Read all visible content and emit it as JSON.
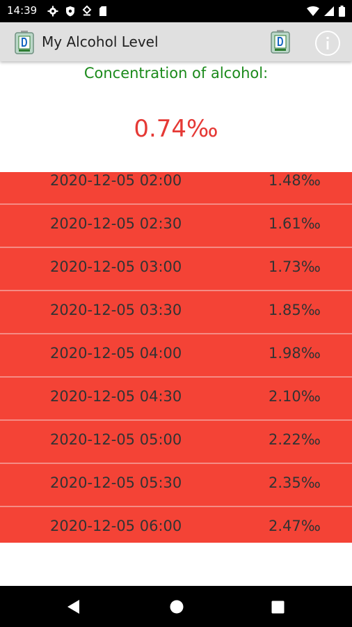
{
  "status_bar": {
    "time": "14:39",
    "left_icons": [
      "settings-gear-icon",
      "shield-icon",
      "vpn-key-icon",
      "sd-card-icon"
    ],
    "right_icons": [
      "wifi-icon",
      "signal-icon",
      "battery-icon"
    ]
  },
  "app_bar": {
    "title": "My Alcohol Level",
    "logo_icon": "breathalyzer-icon",
    "action_icon": "breathalyzer-icon",
    "info_icon": "info-icon"
  },
  "main": {
    "concentration_label": "Concentration of alcohol:",
    "concentration_value": "0.74‰",
    "value_color": "#e53935",
    "label_color": "#1b8a1b"
  },
  "readings": [
    {
      "time": "2020-12-05 02:00",
      "value": "1.48‰"
    },
    {
      "time": "2020-12-05 02:30",
      "value": "1.61‰"
    },
    {
      "time": "2020-12-05 03:00",
      "value": "1.73‰"
    },
    {
      "time": "2020-12-05 03:30",
      "value": "1.85‰"
    },
    {
      "time": "2020-12-05 04:00",
      "value": "1.98‰"
    },
    {
      "time": "2020-12-05 04:30",
      "value": "2.10‰"
    },
    {
      "time": "2020-12-05 05:00",
      "value": "2.22‰"
    },
    {
      "time": "2020-12-05 05:30",
      "value": "2.35‰"
    },
    {
      "time": "2020-12-05 06:00",
      "value": "2.47‰"
    }
  ],
  "list_color": "#f44336",
  "nav_bar": {
    "icons": [
      "back-icon",
      "home-icon",
      "recents-icon"
    ]
  }
}
